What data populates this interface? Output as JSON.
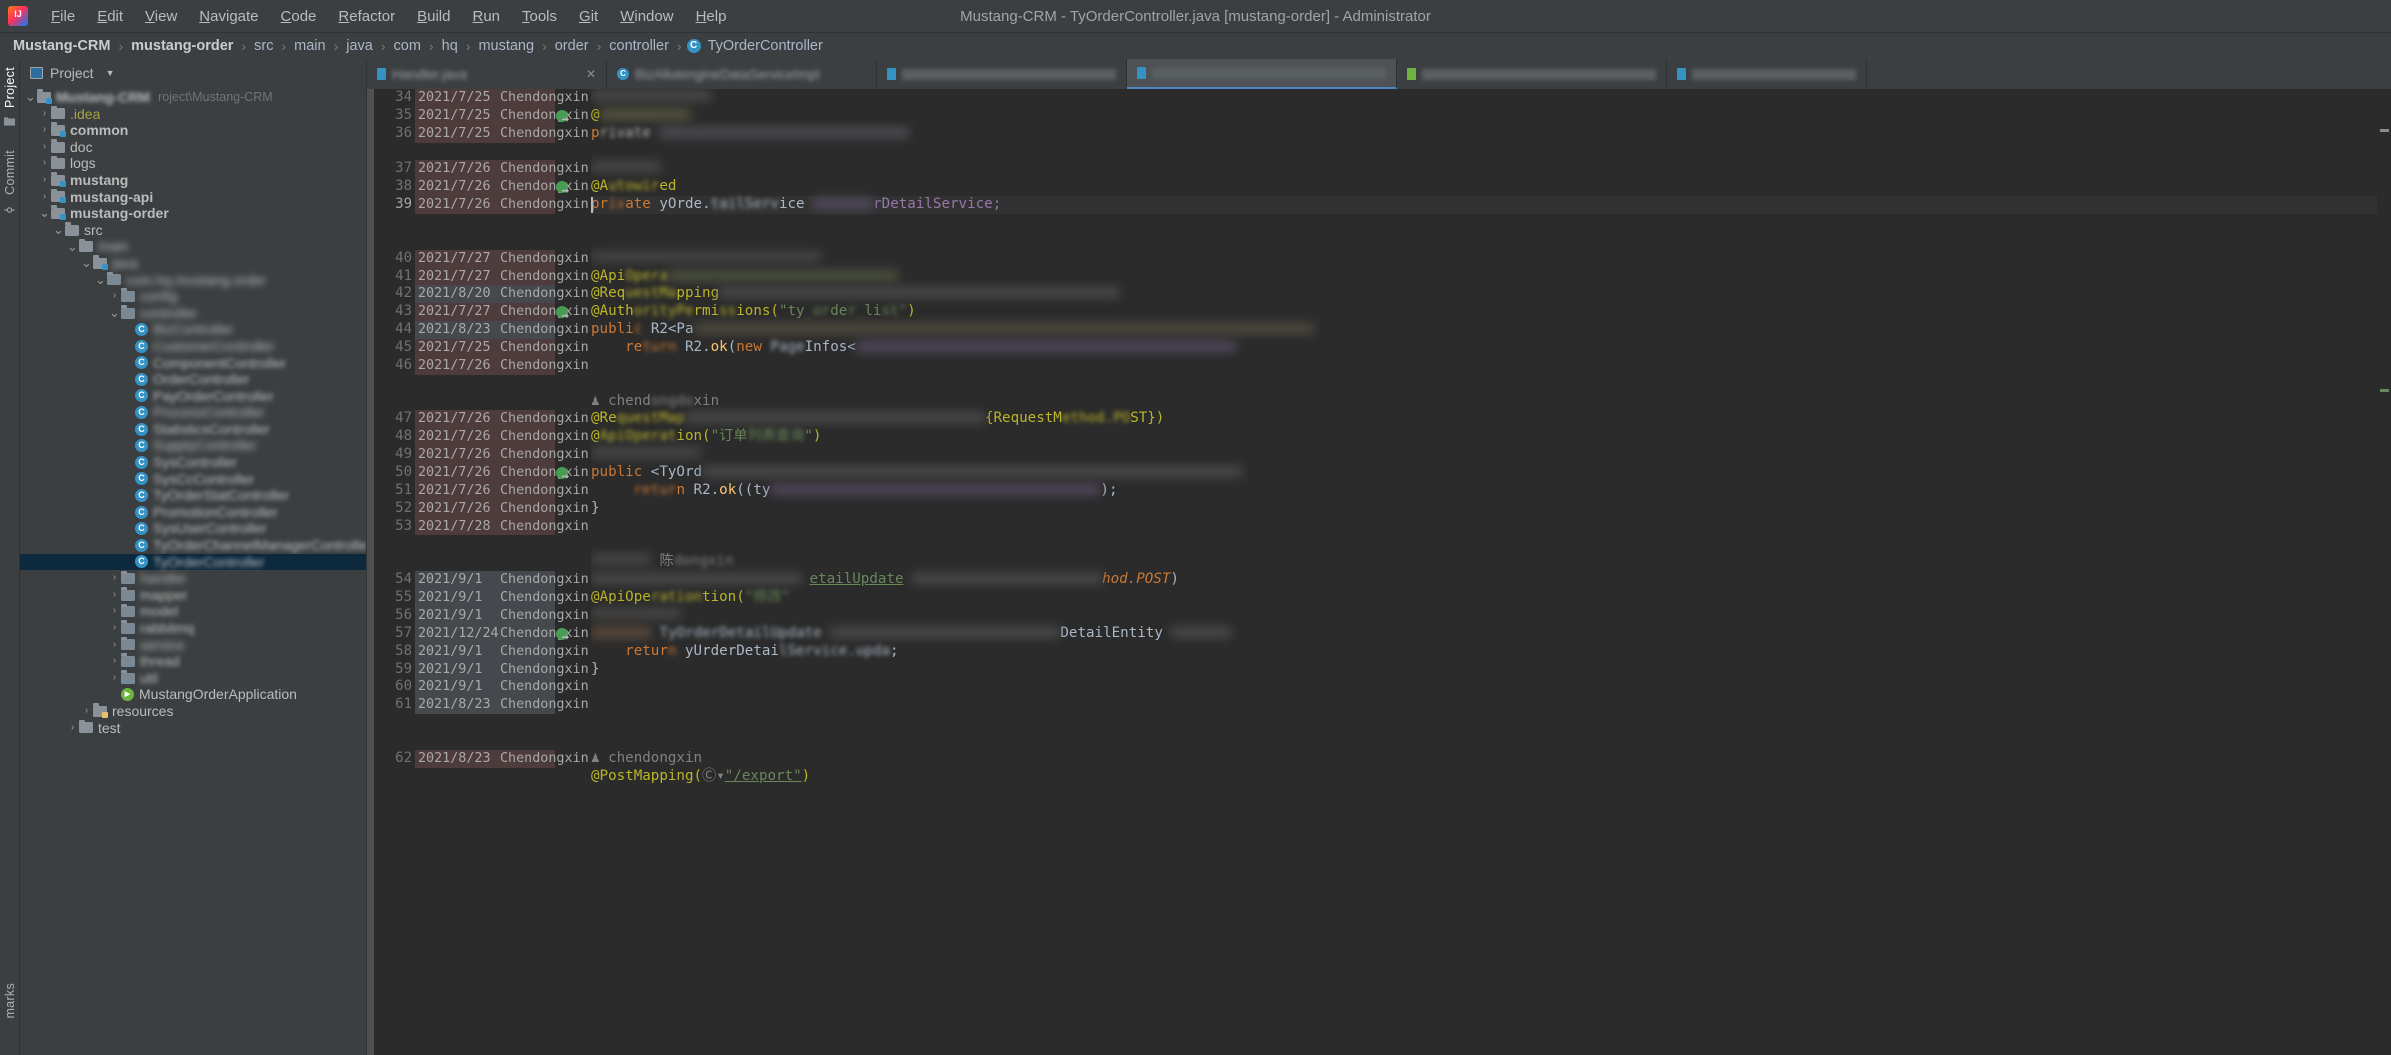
{
  "window": {
    "title": "Mustang-CRM - TyOrderController.java [mustang-order] - Administrator",
    "logo_alt": "IntelliJ IDEA"
  },
  "menu": {
    "items": [
      "File",
      "Edit",
      "View",
      "Navigate",
      "Code",
      "Refactor",
      "Build",
      "Run",
      "Tools",
      "Git",
      "Window",
      "Help"
    ]
  },
  "breadcrumb": {
    "items": [
      {
        "label": "Mustang-CRM",
        "bold": true
      },
      {
        "label": "mustang-order",
        "bold": true
      },
      {
        "label": "src",
        "bold": false
      },
      {
        "label": "main",
        "bold": false
      },
      {
        "label": "java",
        "bold": false
      },
      {
        "label": "com",
        "bold": false
      },
      {
        "label": "hq",
        "bold": false
      },
      {
        "label": "mustang",
        "bold": false
      },
      {
        "label": "order",
        "bold": false
      },
      {
        "label": "controller",
        "bold": false
      }
    ],
    "current_file": "TyOrderController",
    "separator": "›"
  },
  "left_strip": {
    "top": [
      "Project"
    ],
    "second": [
      "Commit"
    ],
    "bottom": [
      "marks"
    ]
  },
  "project_pane": {
    "title": "Project",
    "path_hint": "roject\\Mustang-CRM",
    "tree": [
      {
        "depth": 0,
        "label": "Mustang-CRM",
        "kind": "module",
        "arrow": "down",
        "bold": true,
        "blur": "name"
      },
      {
        "depth": 1,
        "label": ".idea",
        "kind": "folder-idea",
        "arrow": "right",
        "bold": false
      },
      {
        "depth": 1,
        "label": "common",
        "kind": "module",
        "arrow": "right",
        "bold": true
      },
      {
        "depth": 1,
        "label": "doc",
        "kind": "folder",
        "arrow": "right",
        "bold": false
      },
      {
        "depth": 1,
        "label": "logs",
        "kind": "folder",
        "arrow": "right",
        "bold": false
      },
      {
        "depth": 1,
        "label": "mustang",
        "kind": "module",
        "arrow": "right",
        "bold": true
      },
      {
        "depth": 1,
        "label": "mustang-api",
        "kind": "module",
        "arrow": "right",
        "bold": true
      },
      {
        "depth": 1,
        "label": "mustang-order",
        "kind": "module",
        "arrow": "down",
        "bold": true
      },
      {
        "depth": 2,
        "label": "src",
        "kind": "folder",
        "arrow": "down",
        "bold": false
      },
      {
        "depth": 3,
        "label": "main",
        "kind": "folder",
        "arrow": "down",
        "bold": false,
        "blur": "full"
      },
      {
        "depth": 4,
        "label": "java",
        "kind": "src",
        "arrow": "down",
        "bold": false,
        "blur": "full"
      },
      {
        "depth": 5,
        "label": "com.hq.mustang.order",
        "kind": "pkg",
        "arrow": "down",
        "bold": false,
        "blur": "full"
      },
      {
        "depth": 6,
        "label": "config",
        "kind": "pkg",
        "arrow": "right",
        "bold": false,
        "blur": "full"
      },
      {
        "depth": 6,
        "label": "controller",
        "kind": "pkg",
        "arrow": "down",
        "bold": false,
        "blur": "full"
      },
      {
        "depth": 7,
        "label": "BizController",
        "kind": "class",
        "arrow": "none",
        "blur": "full"
      },
      {
        "depth": 7,
        "label": "CustomerController",
        "kind": "class",
        "arrow": "none",
        "blur": "full"
      },
      {
        "depth": 7,
        "label": "ComponentController",
        "kind": "class",
        "arrow": "none",
        "blur": "partial",
        "tail": "nt"
      },
      {
        "depth": 7,
        "label": "OrderController",
        "kind": "class",
        "arrow": "none",
        "blur": "partial",
        "tail": "er"
      },
      {
        "depth": 7,
        "label": "PayOrderController",
        "kind": "class",
        "arrow": "none",
        "blur": "partial",
        "tail": "troller"
      },
      {
        "depth": 7,
        "label": "ProcessController",
        "kind": "class",
        "arrow": "none",
        "blur": "full"
      },
      {
        "depth": 7,
        "label": "StatisticsController",
        "kind": "class",
        "arrow": "none",
        "blur": "partial",
        "tail": "llei"
      },
      {
        "depth": 7,
        "label": "SupplyController",
        "kind": "class",
        "arrow": "none",
        "blur": "full"
      },
      {
        "depth": 7,
        "label": "SysController",
        "kind": "class",
        "arrow": "none",
        "blur": "partial",
        "tail": "is"
      },
      {
        "depth": 7,
        "label": "SysCcController",
        "kind": "class",
        "arrow": "none",
        "blur": "partial",
        "tail": "cCo"
      },
      {
        "depth": 7,
        "label": "TyOrderStatController",
        "kind": "class",
        "arrow": "none",
        "blur": "partial",
        "tail": "rde"
      },
      {
        "depth": 7,
        "label": "PromotionController",
        "kind": "class",
        "arrow": "none",
        "blur": "partial",
        "tail": "rom"
      },
      {
        "depth": 7,
        "label": "SysUserController",
        "kind": "class",
        "arrow": "none",
        "blur": "partial",
        "tail": "ysUs"
      },
      {
        "depth": 7,
        "label": "TyOrderChannelManagerController",
        "kind": "class",
        "arrow": "none",
        "blur": "partial",
        "tail": "TyOr"
      },
      {
        "depth": 7,
        "label": "TyOrderController",
        "kind": "class",
        "arrow": "none",
        "selected": true,
        "blur": "partial",
        "tail": "TyO"
      },
      {
        "depth": 6,
        "label": "handler",
        "kind": "pkg",
        "arrow": "right",
        "bold": false,
        "blur": "full"
      },
      {
        "depth": 6,
        "label": "mapper",
        "kind": "pkg",
        "arrow": "right",
        "bold": false,
        "blur": "partial",
        "tail": "pper"
      },
      {
        "depth": 6,
        "label": "model",
        "kind": "pkg",
        "arrow": "right",
        "bold": false,
        "blur": "partial",
        "tail": "odel"
      },
      {
        "depth": 6,
        "label": "rabbitmq",
        "kind": "pkg",
        "arrow": "right",
        "bold": false,
        "blur": "partial",
        "tail": "bbitmq"
      },
      {
        "depth": 6,
        "label": "service",
        "kind": "pkg",
        "arrow": "right",
        "bold": false,
        "blur": "full"
      },
      {
        "depth": 6,
        "label": "thread",
        "kind": "pkg",
        "arrow": "right",
        "bold": false,
        "blur": "partial",
        "tail": "hread"
      },
      {
        "depth": 6,
        "label": "util",
        "kind": "pkg",
        "arrow": "right",
        "bold": false,
        "blur": "partial",
        "tail": "util"
      },
      {
        "depth": 6,
        "label": "MustangOrderApplication",
        "kind": "spring",
        "arrow": "none"
      },
      {
        "depth": 4,
        "label": "resources",
        "kind": "resources",
        "arrow": "right",
        "bold": false
      },
      {
        "depth": 3,
        "label": "test",
        "kind": "folder",
        "arrow": "right",
        "bold": false
      }
    ]
  },
  "editor_tabs": [
    {
      "label": "Handler.java",
      "icon": "java-file-icon",
      "active": false,
      "closable": true,
      "blur": true
    },
    {
      "label": "BizAllotengineDataServiceImpl",
      "icon": "class-icon",
      "active": false,
      "closable": false,
      "blur": true
    },
    {
      "label": "",
      "icon": "java-file-icon",
      "active": false,
      "closable": false,
      "blur": true
    },
    {
      "label": "",
      "icon": "java-file-icon",
      "active": true,
      "closable": false,
      "blur": true
    },
    {
      "label": "",
      "icon": "spring-icon",
      "active": false,
      "closable": false,
      "blur": true
    },
    {
      "label": "",
      "icon": "java-file-icon",
      "active": false,
      "closable": false,
      "blur": true
    }
  ],
  "editor": {
    "first_line": 34,
    "blame_author": "Chendongxin",
    "lines": [
      {
        "num": 34,
        "date": "2021/7/25",
        "author": "Chendongxin",
        "shade": "c1"
      },
      {
        "num": 35,
        "date": "2021/7/25",
        "author": "Chendongxin",
        "shade": "c1",
        "marker": true
      },
      {
        "num": 36,
        "date": "2021/7/25",
        "author": "Chendongxin",
        "shade": "c1"
      },
      {
        "num": "",
        "date": "",
        "author": "",
        "shade": "empty"
      },
      {
        "num": 37,
        "date": "2021/7/26",
        "author": "Chendongxin",
        "shade": "c1"
      },
      {
        "num": 38,
        "date": "2021/7/26",
        "author": "Chendongxin",
        "shade": "c1",
        "marker": true
      },
      {
        "num": 39,
        "date": "2021/7/26",
        "author": "Chendongxin",
        "shade": "c1",
        "current": true
      },
      {
        "num": "",
        "date": "",
        "author": "",
        "shade": "empty"
      },
      {
        "num": "",
        "date": "",
        "author": "",
        "shade": "empty"
      },
      {
        "num": 40,
        "date": "2021/7/27",
        "author": "Chendongxin",
        "shade": "c1"
      },
      {
        "num": 41,
        "date": "2021/7/27",
        "author": "Chendongxin",
        "shade": "c1"
      },
      {
        "num": 42,
        "date": "2021/8/20",
        "author": "Chendongxin",
        "shade": "c2"
      },
      {
        "num": 43,
        "date": "2021/7/27",
        "author": "Chendongxin",
        "shade": "c1",
        "marker": true
      },
      {
        "num": 44,
        "date": "2021/8/23",
        "author": "Chendongxin",
        "shade": "c2"
      },
      {
        "num": 45,
        "date": "2021/7/25",
        "author": "Chendongxin",
        "shade": "c1"
      },
      {
        "num": 46,
        "date": "2021/7/26",
        "author": "Chendongxin",
        "shade": "c1"
      },
      {
        "num": "",
        "date": "",
        "author": "",
        "shade": "empty"
      },
      {
        "num": "",
        "date": "",
        "author": "",
        "shade": "empty"
      },
      {
        "num": 47,
        "date": "2021/7/26",
        "author": "Chendongxin",
        "shade": "c1"
      },
      {
        "num": 48,
        "date": "2021/7/26",
        "author": "Chendongxin",
        "shade": "c1"
      },
      {
        "num": 49,
        "date": "2021/7/26",
        "author": "Chendongxin",
        "shade": "c1"
      },
      {
        "num": 50,
        "date": "2021/7/26",
        "author": "Chendongxin",
        "shade": "c1",
        "marker": true
      },
      {
        "num": 51,
        "date": "2021/7/26",
        "author": "Chendongxin",
        "shade": "c1"
      },
      {
        "num": 52,
        "date": "2021/7/26",
        "author": "Chendongxin",
        "shade": "c1"
      },
      {
        "num": 53,
        "date": "2021/7/28",
        "author": "Chendongxin",
        "shade": "c1"
      },
      {
        "num": "",
        "date": "",
        "author": "",
        "shade": "empty"
      },
      {
        "num": "",
        "date": "",
        "author": "",
        "shade": "empty"
      },
      {
        "num": 54,
        "date": "2021/9/1",
        "author": "Chendongxin",
        "shade": "c2"
      },
      {
        "num": 55,
        "date": "2021/9/1",
        "author": "Chendongxin",
        "shade": "c2"
      },
      {
        "num": 56,
        "date": "2021/9/1",
        "author": "Chendongxin",
        "shade": "c2"
      },
      {
        "num": 57,
        "date": "2021/12/24",
        "author": "Chendongxin",
        "shade": "c2",
        "marker": true
      },
      {
        "num": 58,
        "date": "2021/9/1",
        "author": "Chendongxin",
        "shade": "c2"
      },
      {
        "num": 59,
        "date": "2021/9/1",
        "author": "Chendongxin",
        "shade": "c2"
      },
      {
        "num": 60,
        "date": "2021/9/1",
        "author": "Chendongxin",
        "shade": "c2"
      },
      {
        "num": 61,
        "date": "2021/8/23",
        "author": "Chendongxin",
        "shade": "c2"
      },
      {
        "num": "",
        "date": "",
        "author": "",
        "shade": "empty"
      },
      {
        "num": "",
        "date": "",
        "author": "",
        "shade": "empty"
      },
      {
        "num": 62,
        "date": "2021/8/23",
        "author": "Chendongxin",
        "shade": "c1"
      }
    ],
    "code_fragments": {
      "l35_private": "private",
      "l35_rest": "rDetailService;",
      "l37_autowired": "@Autowired",
      "l38_private": "private",
      "l38_type": "yOrde.",
      "l38_field": "rDetailService;",
      "l40_apiopera": "@ApiOpera",
      "l41_requestmapping": "@RequestMapping",
      "l42_authperm": "@AuthPermissions(\"ty_de_li",
      "l43_public": "public",
      "l43_ret": "R2<Pa",
      "l44_return": "return",
      "l44_r2ok": "R2.ok(new",
      "l44_infos": "Infos<",
      "l46_blame_user": "chendongxin",
      "l47_req": "@RequestMapping",
      "l47_method": "{RequestMethod.POST})",
      "l50_public": "public",
      "l50_type": "<TyOrd",
      "l51_return": "n R2.ok((ty",
      "l52_brace": "}",
      "l53_blame_user": "chendongxin",
      "l54_detailupdate": "etailUpdate",
      "l54_post": "hod.POST)",
      "l55_apiope": "@ApiOpe",
      "l55_ration": "ation(",
      "l57_entity": "DetailEntity",
      "l58_return": "return",
      "l58_call": "yUrderDetai",
      "l59_brace": "}",
      "l61_blame_user": "chendongxin",
      "l62_postmapping": "@PostMapping(",
      "l62_export": "\"/export\"",
      "l62_close": ")"
    }
  },
  "colors": {
    "accent": "#3592c4",
    "editor_bg": "#2b2b2b",
    "chrome_bg": "#3c3f41",
    "blame_old": "#4e3b3b",
    "blame_new": "#45484d",
    "selection": "#0d293e",
    "spring_green": "#6db33f",
    "annotation": "#bbb529",
    "keyword": "#cc7832",
    "string": "#6a8759",
    "field": "#9876aa",
    "method": "#ffc66d"
  }
}
